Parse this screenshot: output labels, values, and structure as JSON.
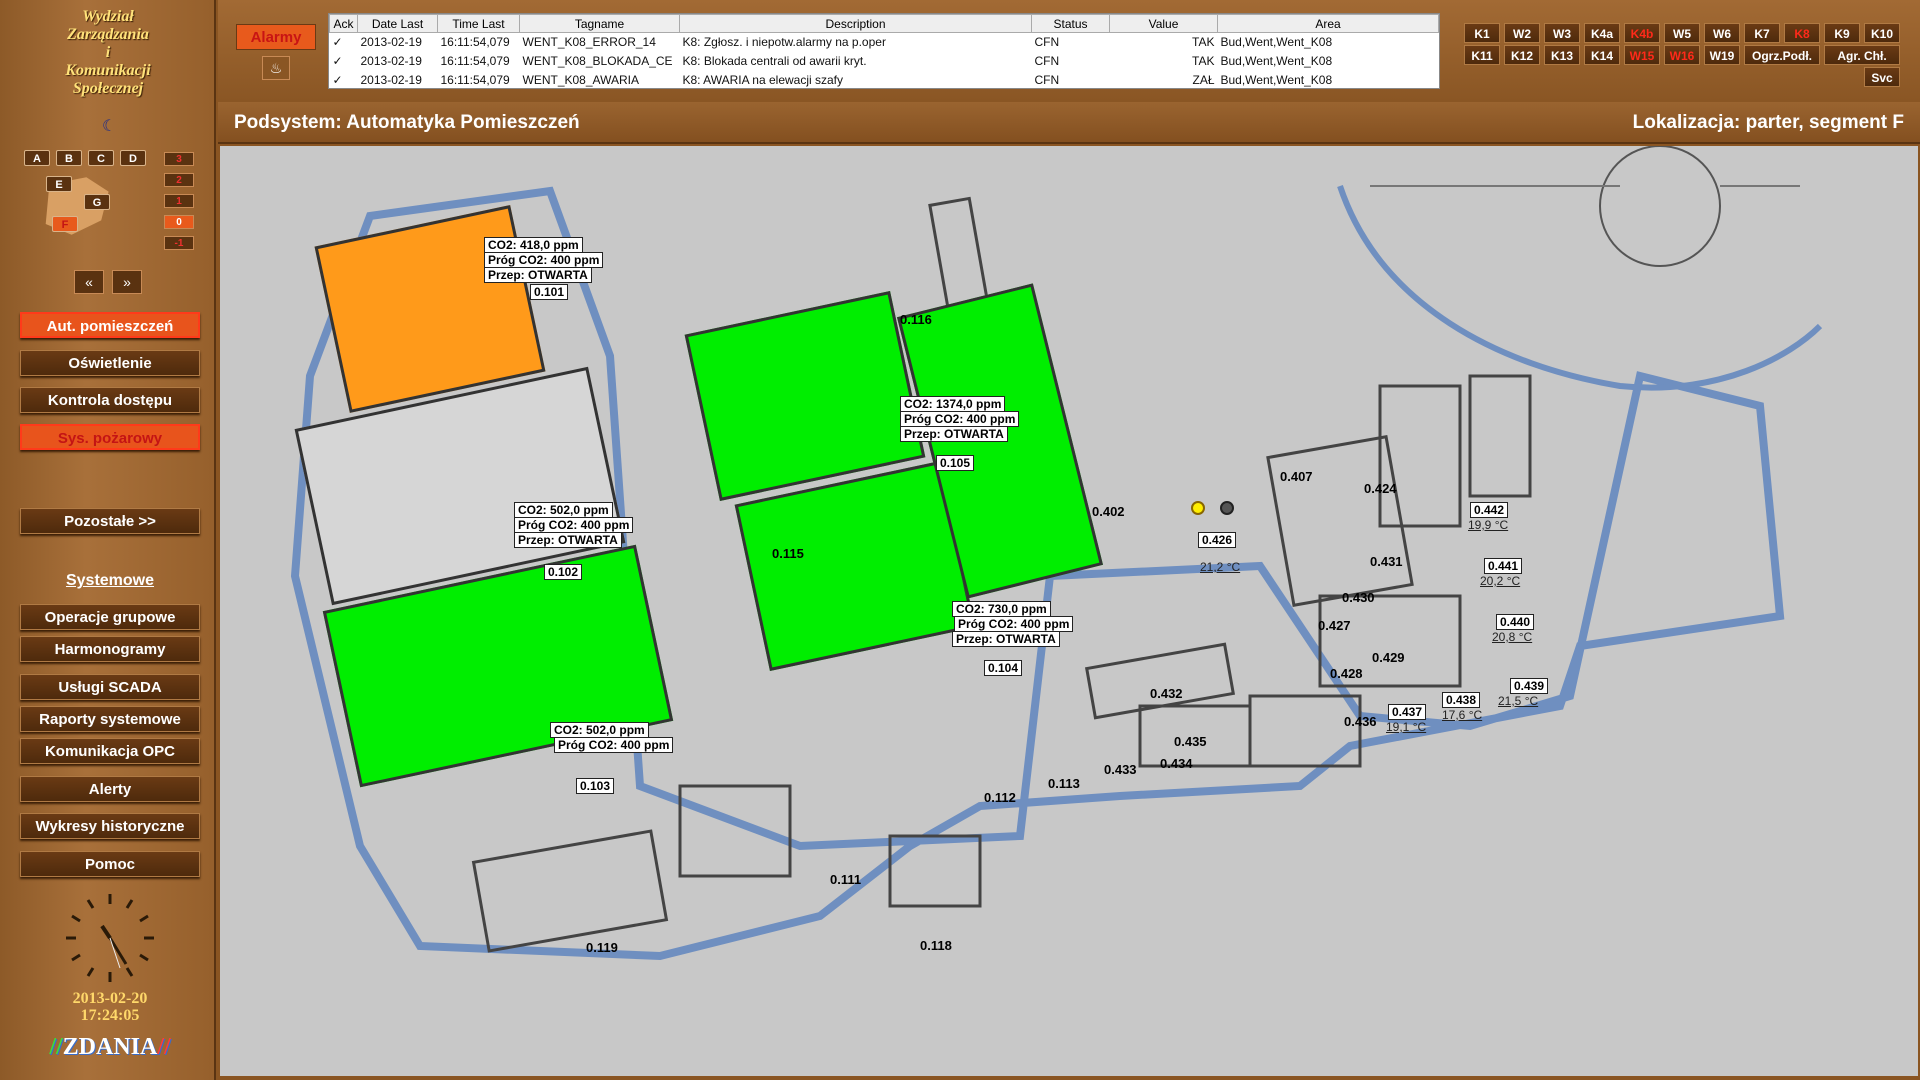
{
  "sidebar": {
    "logo_lines": [
      "Wydział",
      "Zarządzania",
      "i",
      "Komunikacji",
      "Społecznej"
    ],
    "building_buttons": [
      "A",
      "B",
      "C",
      "D",
      "E",
      "G",
      "F"
    ],
    "floor_buttons": [
      "3",
      "2",
      "1",
      "0",
      "-1"
    ],
    "prev_label": "«",
    "next_label": "»",
    "nav": {
      "aut": "Aut. pomieszczeń",
      "oswietlenie": "Oświetlenie",
      "kontrola": "Kontrola dostępu",
      "sys_poz": "Sys. pożarowy",
      "pozostale": "Pozostałe  >>",
      "systemowe": "Systemowe",
      "operacje": "Operacje grupowe",
      "harmonogramy": "Harmonogramy",
      "uslugi": "Usługi SCADA",
      "raporty": "Raporty systemowe",
      "opc": "Komunikacja OPC",
      "alerty": "Alerty",
      "wykresy": "Wykresy historyczne",
      "pomoc": "Pomoc"
    },
    "date": "2013-02-20",
    "time": "17:24:05",
    "brand": "ZDANIA"
  },
  "alarms": {
    "button": "Alarmy",
    "columns": [
      "Ack",
      "Date Last",
      "Time Last",
      "Tagname",
      "Description",
      "Status",
      "Value",
      "Area"
    ],
    "rows": [
      [
        "✓",
        "2013-02-19",
        "16:11:54,079",
        "WENT_K08_ERROR_14",
        "K8: Zgłosz. i niepotw.alarmy na p.oper",
        "CFN",
        "TAK",
        "Bud,Went,Went_K08"
      ],
      [
        "✓",
        "2013-02-19",
        "16:11:54,079",
        "WENT_K08_BLOKADA_CE",
        "K8: Blokada centrali od awarii kryt.",
        "CFN",
        "TAK",
        "Bud,Went,Went_K08"
      ],
      [
        "✓",
        "2013-02-19",
        "16:11:54,079",
        "WENT_K08_AWARIA",
        "K8: AWARIA na elewacji szafy",
        "CFN",
        "ZAŁ",
        "Bud,Went,Went_K08"
      ]
    ]
  },
  "zones": {
    "row1": [
      "K1",
      "W2",
      "W3",
      "K4a",
      "K4b",
      "W5",
      "W6",
      "K7",
      "K8",
      "K9",
      "K10"
    ],
    "row2": [
      "K11",
      "K12",
      "K13",
      "K14",
      "W15",
      "W16",
      "W19",
      "Ogrz.Podł.",
      "Agr. Chł."
    ],
    "svc": "Svc"
  },
  "header": {
    "subsystem": "Podsystem: Automatyka Pomieszczeń",
    "location": "Lokalizacja: parter, segment F"
  },
  "rooms": {
    "r101": {
      "id": "0.101",
      "co2": "CO2: 418,0 ppm",
      "prog": "Próg CO2: 400 ppm",
      "przep": "Przep: OTWARTA"
    },
    "r102": {
      "id": "0.102",
      "co2": "CO2: 502,0 ppm",
      "prog": "Próg CO2: 400 ppm",
      "przep": "Przep: OTWARTA"
    },
    "r103": {
      "id": "0.103",
      "co2": "CO2: 502,0 ppm",
      "prog": "Próg CO2: 400 ppm"
    },
    "r104": {
      "id": "0.104",
      "co2": "CO2: 730,0 ppm",
      "prog": "Próg CO2: 400 ppm",
      "przep": "Przep: OTWARTA"
    },
    "r105": {
      "id": "0.105",
      "co2": "CO2: 1374,0 ppm",
      "prog": "Próg CO2: 400 ppm",
      "przep": "Przep: OTWARTA"
    },
    "r426": {
      "id": "0.426",
      "temp": "21,2 °C"
    },
    "r442": {
      "id": "0.442",
      "temp": "19,9 °C"
    },
    "r441": {
      "id": "0.441",
      "temp": "20,2 °C"
    },
    "r440": {
      "id": "0.440",
      "temp": "20,8 °C"
    },
    "r439": {
      "id": "0.439",
      "temp": "21,5 °C"
    },
    "r438": {
      "id": "0.438",
      "temp": "17,6 °C"
    },
    "r437": {
      "id": "0.437",
      "temp": "19,1 °C"
    }
  },
  "plain_rooms": {
    "r116": "0.116",
    "r115": "0.115",
    "r402": "0.402",
    "r407": "0.407",
    "r424": "0.424",
    "r431": "0.431",
    "r430": "0.430",
    "r427": "0.427",
    "r429": "0.429",
    "r428": "0.428",
    "r432": "0.432",
    "r435": "0.435",
    "r434": "0.434",
    "r433": "0.433",
    "r436": "0.436",
    "r112": "0.112",
    "r113": "0.113",
    "r111": "0.111",
    "r119": "0.119",
    "r118": "0.118"
  },
  "colors": {
    "green": "#00ee00",
    "orange": "#ff9a1a",
    "gray_room": "#d6d6d6",
    "floor": "#c8c8c8",
    "wall_blue": "#6f8fc0"
  }
}
